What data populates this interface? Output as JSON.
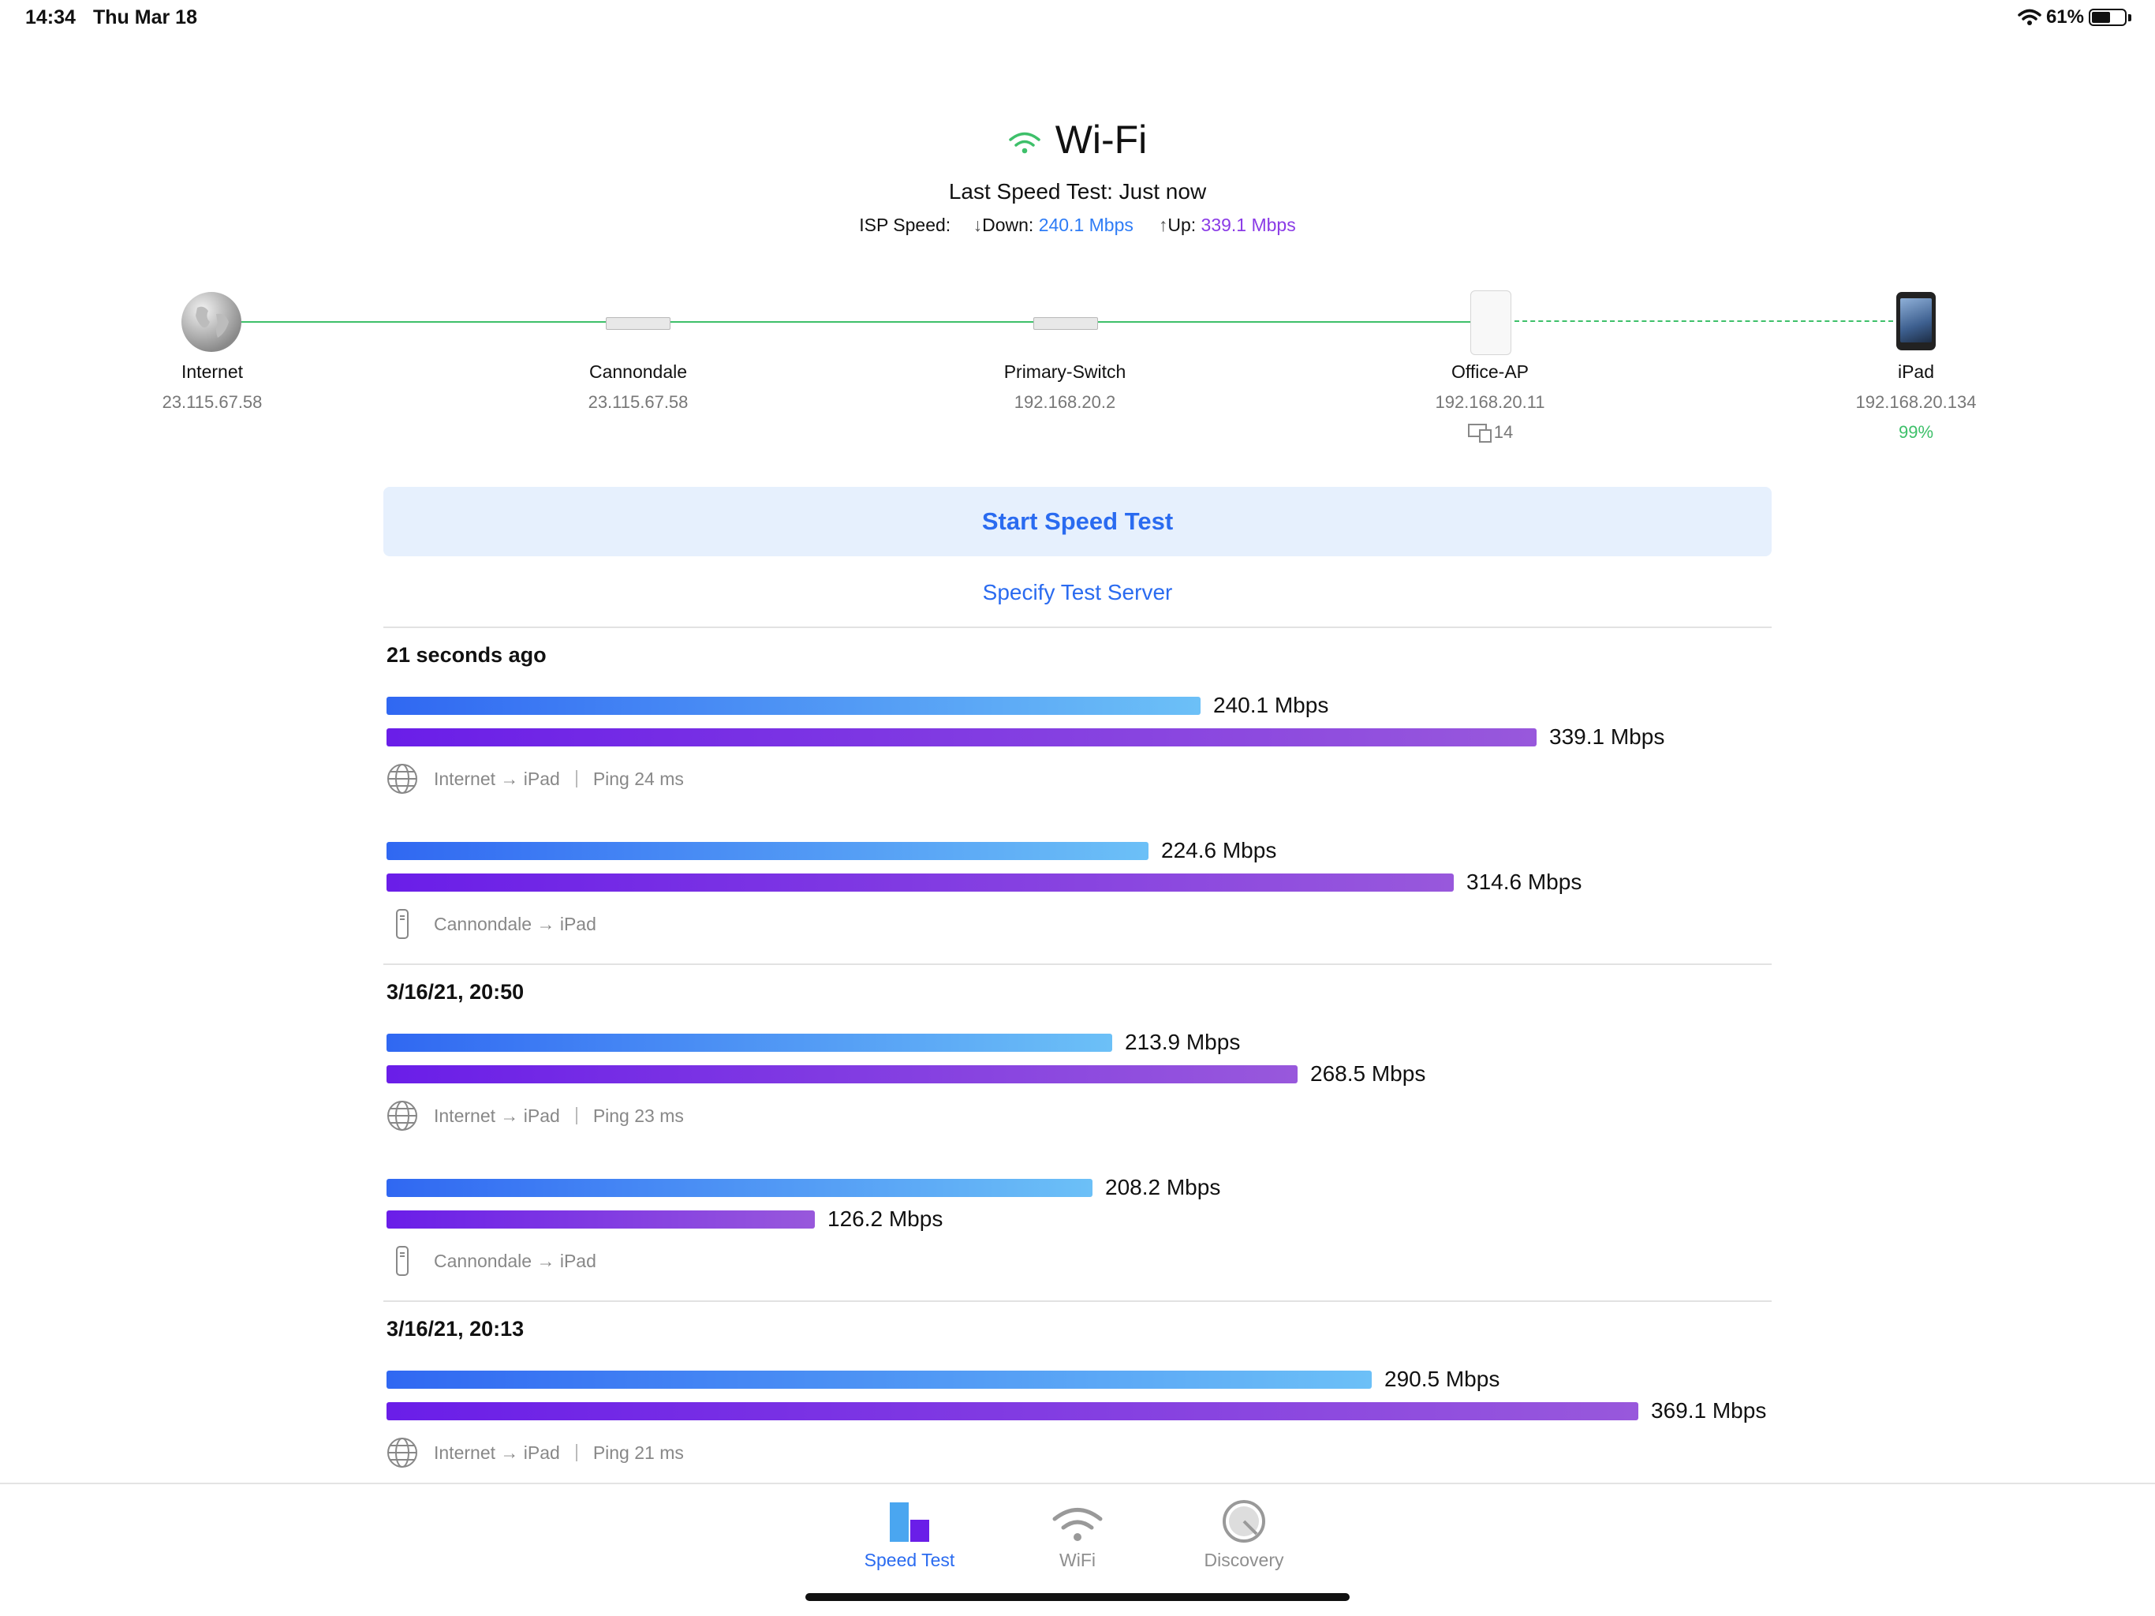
{
  "status_bar": {
    "time": "14:34",
    "date": "Thu Mar 18",
    "battery": "61%",
    "battery_level": 0.61
  },
  "header": {
    "title": "Wi-Fi",
    "last_speed_test": "Last Speed Test: Just now",
    "isp_label": "ISP Speed:",
    "down_label": "Down:",
    "down_value": "240.1 Mbps",
    "up_label": "Up:",
    "up_value": "339.1 Mbps"
  },
  "topology": {
    "nodes": [
      {
        "name": "Internet",
        "ip": "23.115.67.58",
        "icon": "globe-icon"
      },
      {
        "name": "Cannondale",
        "ip": "23.115.67.58",
        "icon": "gateway-icon"
      },
      {
        "name": "Primary-Switch",
        "ip": "192.168.20.2",
        "icon": "switch-icon"
      },
      {
        "name": "Office-AP",
        "ip": "192.168.20.11",
        "clients": "14",
        "icon": "access-point-icon"
      },
      {
        "name": "iPad",
        "ip": "192.168.20.134",
        "signal": "99%",
        "icon": "ipad-icon"
      }
    ]
  },
  "actions": {
    "start_label": "Start Speed Test",
    "specify_label": "Specify Test Server"
  },
  "results": [
    {
      "title": "21 seconds ago",
      "tests": [
        {
          "down": "240.1 Mbps",
          "down_value": 240.1,
          "up": "339.1 Mbps",
          "up_value": 339.1,
          "route": "Internet → iPad",
          "ping": "Ping 24 ms",
          "icon": "globe-icon"
        },
        {
          "down": "224.6 Mbps",
          "down_value": 224.6,
          "up": "314.6 Mbps",
          "up_value": 314.6,
          "route": "Cannondale → iPad",
          "ping": "",
          "icon": "gateway-icon"
        }
      ]
    },
    {
      "title": "3/16/21, 20:50",
      "tests": [
        {
          "down": "213.9 Mbps",
          "down_value": 213.9,
          "up": "268.5 Mbps",
          "up_value": 268.5,
          "route": "Internet → iPad",
          "ping": "Ping 23 ms",
          "icon": "globe-icon"
        },
        {
          "down": "208.2 Mbps",
          "down_value": 208.2,
          "up": "126.2 Mbps",
          "up_value": 126.2,
          "route": "Cannondale → iPad",
          "ping": "",
          "icon": "gateway-icon"
        }
      ]
    },
    {
      "title": "3/16/21, 20:13",
      "tests": [
        {
          "down": "290.5 Mbps",
          "down_value": 290.5,
          "up": "369.1 Mbps",
          "up_value": 369.1,
          "route": "Internet → iPad",
          "ping": "Ping 21 ms",
          "icon": "globe-icon"
        }
      ]
    }
  ],
  "tabbar": {
    "tabs": [
      {
        "label": "Speed Test",
        "icon": "speed-test-icon",
        "active": true
      },
      {
        "label": "WiFi",
        "icon": "wifi-icon",
        "active": false
      },
      {
        "label": "Discovery",
        "icon": "discovery-icon",
        "active": false
      }
    ]
  },
  "colors": {
    "accent": "#2a6bf0",
    "download": "#3068f2",
    "upload": "#6a1ee8",
    "link": "#3ec06a"
  }
}
